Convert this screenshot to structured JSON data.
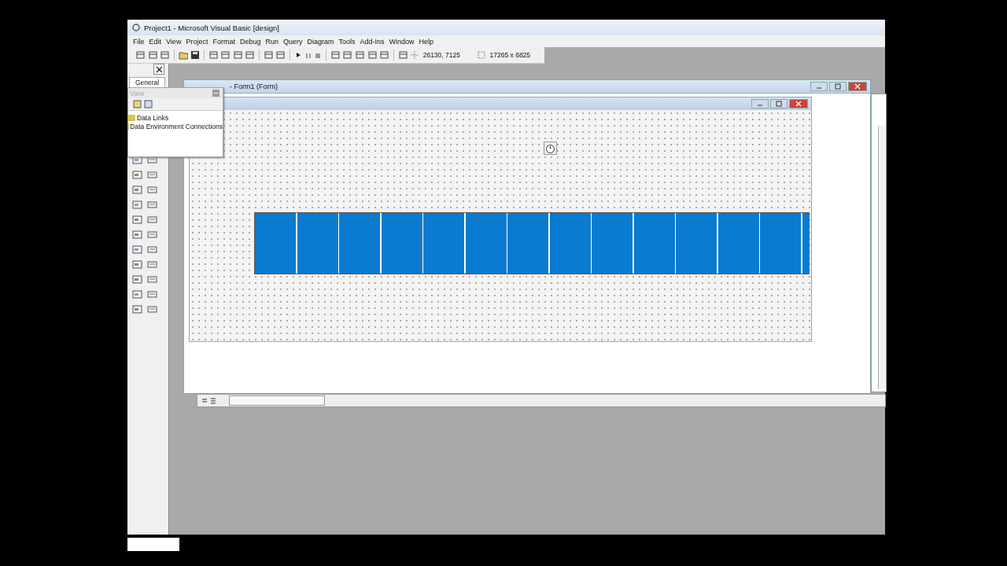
{
  "window": {
    "title": "Project1 - Microsoft Visual Basic [design]"
  },
  "menu": [
    "File",
    "Edit",
    "View",
    "Project",
    "Format",
    "Debug",
    "Run",
    "Query",
    "Diagram",
    "Tools",
    "Add-Ins",
    "Window",
    "Help"
  ],
  "toolbar": {
    "position": "26130, 7125",
    "size": "17265 x 6825"
  },
  "toolbox": {
    "tab": "General"
  },
  "data_view": {
    "title": "View",
    "items": [
      "Data Links",
      "Data Environment Connections"
    ]
  },
  "code_window": {
    "title": "- Form1 (Form)"
  }
}
